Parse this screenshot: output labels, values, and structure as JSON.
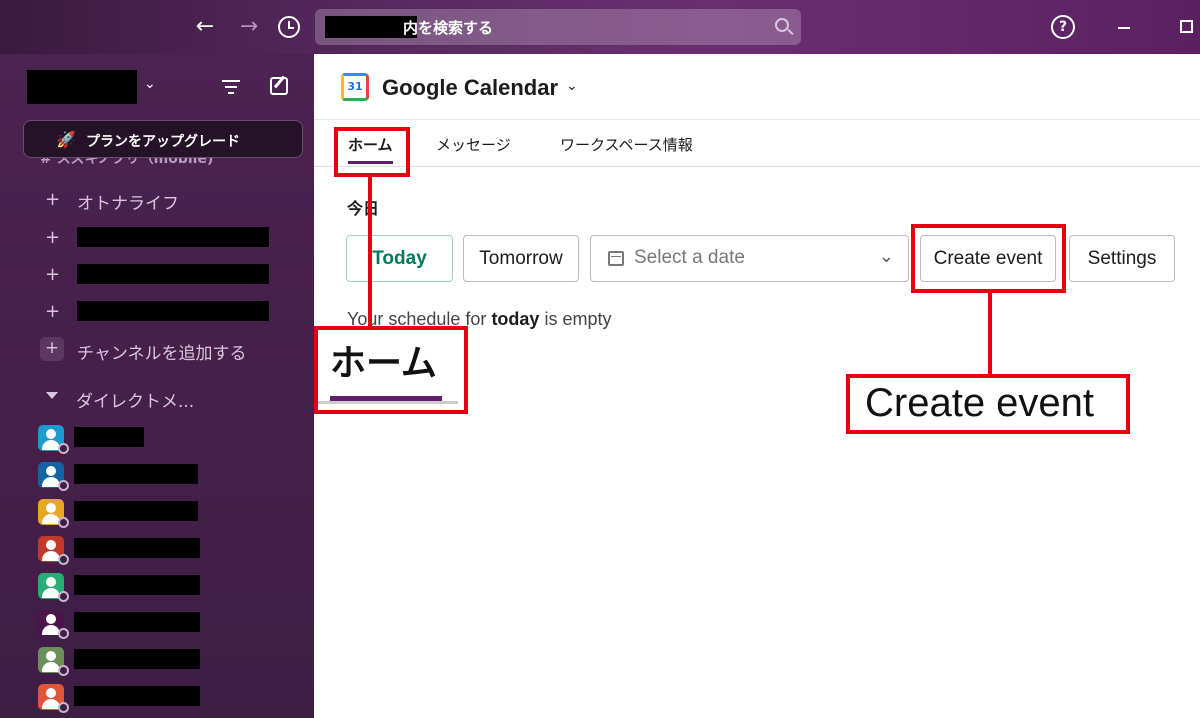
{
  "titlebar": {
    "back_icon": "←",
    "forward_icon": "→",
    "search_placeholder": "内を検索する",
    "help_icon": "?"
  },
  "sidebar": {
    "workspace_chevron": "⌄",
    "upgrade_label": "プランをアップグレード",
    "upgrade_icon": "🚀",
    "ghost_channel": "# スズキノブリ（mobile)",
    "channels": [
      {
        "plus": "+",
        "name": "オトナライフ"
      },
      {
        "plus": "+",
        "name": ""
      },
      {
        "plus": "+",
        "name": ""
      },
      {
        "plus": "+",
        "name": ""
      }
    ],
    "add_channel_plus": "+",
    "add_channel_label": "チャンネルを追加する",
    "dm_header": "ダイレクトメ..."
  },
  "main": {
    "app_logo_text": "31",
    "app_title": "Google Calendar",
    "app_chevron": "⌄",
    "tabs": [
      {
        "label": "ホーム"
      },
      {
        "label": "メッセージ"
      },
      {
        "label": "ワークスペース情報"
      }
    ],
    "today_heading": "今日",
    "buttons": {
      "today": "Today",
      "tomorrow": "Tomorrow",
      "date_placeholder": "Select a date",
      "create_event": "Create event",
      "settings": "Settings"
    },
    "empty_prefix": "Your schedule for ",
    "empty_bold": "today",
    "empty_suffix": " is empty",
    "select_chevron": "⌄"
  },
  "annotations": {
    "zoom_home_label": "ホーム",
    "zoom_create_label": "Create event",
    "highlight_color": "#e60012"
  },
  "colors": {
    "sidebar_bg": "#3f1d45",
    "titlebar_bg": "#5a2a62",
    "accent": "#611f69",
    "today_green": "#007a5a"
  }
}
